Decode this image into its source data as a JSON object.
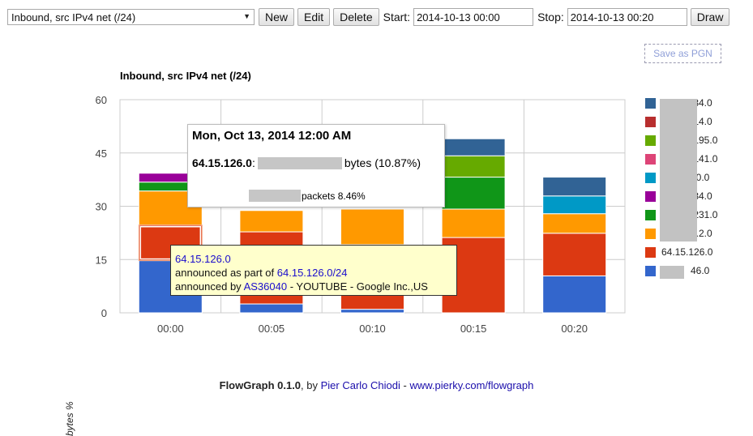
{
  "toolbar": {
    "graph_select": "Inbound, src IPv4 net (/24)",
    "new_label": "New",
    "edit_label": "Edit",
    "delete_label": "Delete",
    "start_label": "Start:",
    "start_value": "2014-10-13 00:00",
    "stop_label": "Stop:",
    "stop_value": "2014-10-13 00:20",
    "draw_label": "Draw"
  },
  "save_pgn": "Save as PGN",
  "chart_data": {
    "type": "bar",
    "stacked": true,
    "title": "Inbound, src IPv4 net (/24)",
    "ylabel": "bytes %",
    "ylim": [
      0,
      60
    ],
    "yticks": [
      "0",
      "15",
      "30",
      "45",
      "60"
    ],
    "categories": [
      "00:00",
      "00:05",
      "00:10",
      "00:15",
      "00:20"
    ],
    "series": [
      {
        "name": "...46.0",
        "color": "#3366cc",
        "values": [
          14.7,
          2.5,
          1.0,
          0.0,
          10.4
        ]
      },
      {
        "name": "64.15.126.0",
        "color": "#dc3912",
        "values": [
          10.0,
          20.3,
          18.2,
          21.2,
          12.0
        ]
      },
      {
        "name": "...4.2.0",
        "color": "#ff9900",
        "values": [
          9.6,
          6.0,
          10.0,
          8.0,
          5.5
        ]
      },
      {
        "name": "...231.0",
        "color": "#109618",
        "values": [
          2.5,
          0.0,
          0.0,
          9.0,
          0.0
        ]
      },
      {
        "name": "...34.0",
        "color": "#990099",
        "values": [
          2.5,
          0.0,
          0.0,
          0.0,
          0.0
        ]
      },
      {
        "name": "...0.0",
        "color": "#0099c6",
        "values": [
          0.0,
          0.0,
          0.0,
          0.0,
          5.0
        ]
      },
      {
        "name": "...141.0",
        "color": "#dd4477",
        "values": [
          0.0,
          0.0,
          0.0,
          0.0,
          0.0
        ]
      },
      {
        "name": "...195.0",
        "color": "#66aa00",
        "values": [
          0.0,
          0.0,
          0.0,
          6.0,
          0.0
        ]
      },
      {
        "name": "...14.0",
        "color": "#b82e2e",
        "values": [
          0.0,
          0.0,
          0.0,
          0.0,
          0.0
        ]
      },
      {
        "name": "...134.0",
        "color": "#316395",
        "values": [
          0.0,
          0.0,
          0.0,
          4.8,
          5.3
        ]
      }
    ]
  },
  "legend": [
    {
      "text": ".34.0",
      "color": "#316395"
    },
    {
      "text": ".14.0",
      "color": "#b82e2e"
    },
    {
      "text": ".195.0",
      "color": "#66aa00"
    },
    {
      "text": ".141.0",
      "color": "#dd4477"
    },
    {
      "text": "40.0",
      "color": "#0099c6"
    },
    {
      "text": ".34.0",
      "color": "#990099"
    },
    {
      "text": ".231.0",
      "color": "#109618"
    },
    {
      "text": "4.2.0",
      "color": "#ff9900"
    },
    {
      "text": "64.15.126.0",
      "color": "#dc3912"
    },
    {
      "text": "46.0",
      "color": "#3366cc"
    }
  ],
  "hover_tooltip": {
    "date": "Mon, Oct 13, 2014 12:00 AM",
    "network": "64.15.126.0",
    "colon": ":",
    "bytes_text": "bytes (10.87%)",
    "packets_text": "packets 8.46%"
  },
  "info_tooltip": {
    "network": "64.15.126.0",
    "announced_part_prefix": "announced as part of ",
    "announced_part_link": "64.15.126.0/24",
    "announced_by_prefix": "announced by ",
    "asn_link": "AS36040",
    "asn_desc": " - YOUTUBE - Google Inc.,US"
  },
  "footer": {
    "app_name": "FlowGraph 0.1.0",
    "by": ", by ",
    "author": "Pier Carlo Chiodi",
    "sep": " - ",
    "url": "www.pierky.com/flowgraph"
  }
}
